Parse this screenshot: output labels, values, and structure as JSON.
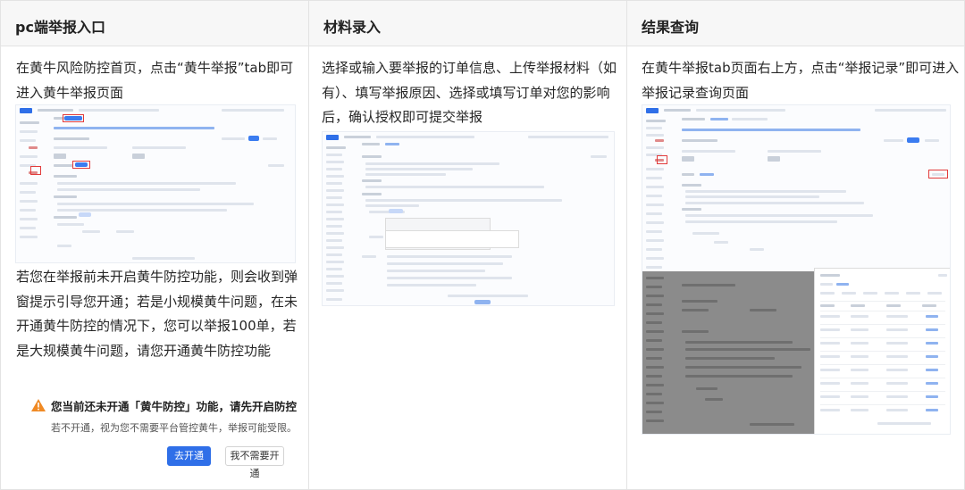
{
  "columns": [
    {
      "header": "pc端举报入口",
      "paragraphs": [
        "在黄牛风险防控首页，点击“黄牛举报”tab即可进入黄牛举报页面",
        "若您在举报前未开启黄牛防控功能，则会收到弹窗提示引导您开通；若是小规模黄牛问题，在未开通黄牛防控的情况下，您可以举报100单，若是大规模黄牛问题，请您开通黄牛防控功能"
      ],
      "dialog": {
        "title": "您当前还未开通「黄牛防控」功能，请先开启防控",
        "subtitle": "若不开通，视为您不需要平台管控黄牛，举报可能受限。",
        "primary_button": "去开通",
        "secondary_button": "我不需要开通"
      }
    },
    {
      "header": "材料录入",
      "paragraphs": [
        "选择或输入要举报的订单信息、上传举报材料（如有）、填写举报原因、选择或填写订单对您的影响后，确认授权即可提交举报"
      ]
    },
    {
      "header": "结果查询",
      "paragraphs": [
        "在黄牛举报tab页面右上方，点击“举报记录”即可进入举报记录查询页面"
      ]
    }
  ],
  "colors": {
    "header_bg": "#f7f7f7",
    "border": "#e3e3e3",
    "accent_blue": "#2f6fe8",
    "warning_orange": "#f08a24",
    "highlight_red": "#e23b3b"
  }
}
